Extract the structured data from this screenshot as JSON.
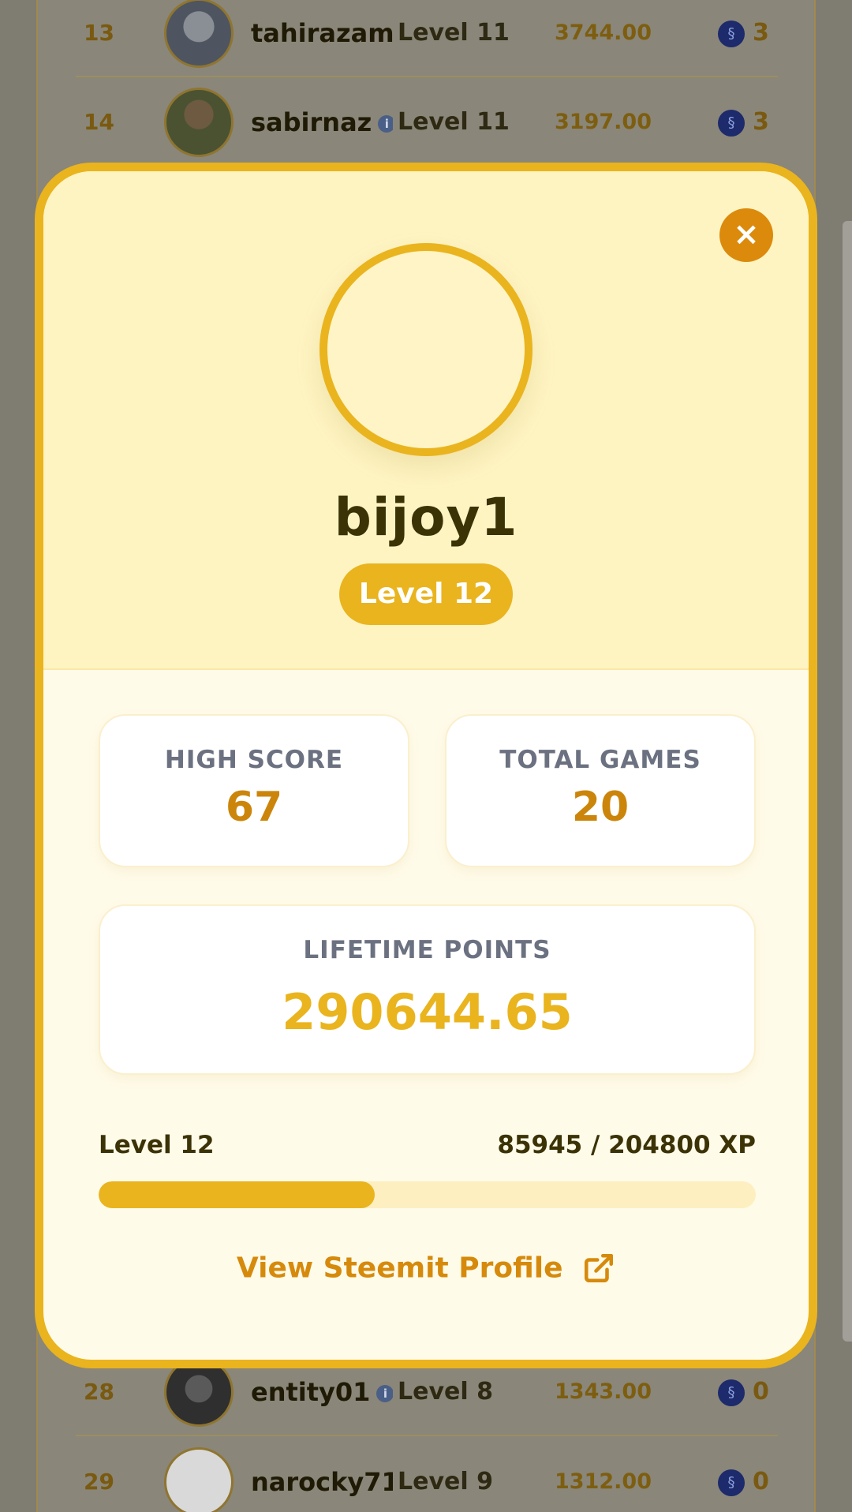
{
  "leaderboard": {
    "rows": [
      {
        "rank": "13",
        "name": "tahirazam",
        "level": "Level 11",
        "points": "3744.00",
        "reward": "3",
        "info": false
      },
      {
        "rank": "14",
        "name": "sabirnaz",
        "level": "Level 11",
        "points": "3197.00",
        "reward": "3",
        "info": true
      },
      {
        "rank": "28",
        "name": "entity01",
        "level": "Level 8",
        "points": "1343.00",
        "reward": "0",
        "info": true
      },
      {
        "rank": "29",
        "name": "narocky71",
        "level": "Level 9",
        "points": "1312.00",
        "reward": "0",
        "info": false
      }
    ],
    "info_glyph": "i",
    "coin_icon": "steem-coin-icon"
  },
  "modal": {
    "close_glyph": "×",
    "username": "bijoy1",
    "level_badge": "Level 12",
    "stats": {
      "high_score_label": "HIGH SCORE",
      "high_score_value": "67",
      "total_games_label": "TOTAL GAMES",
      "total_games_value": "20",
      "lifetime_label": "LIFETIME POINTS",
      "lifetime_value": "290644.65"
    },
    "progress": {
      "level_label": "Level 12",
      "xp_text": "85945 / 204800 XP",
      "xp_current": 85945,
      "xp_target": 204800
    },
    "steemit_link": "View Steemit Profile"
  },
  "colors": {
    "accent": "#e9b41e",
    "accent_dark": "#db8a0c",
    "text_dark": "#3b3206",
    "label_gray": "#6b7180"
  }
}
